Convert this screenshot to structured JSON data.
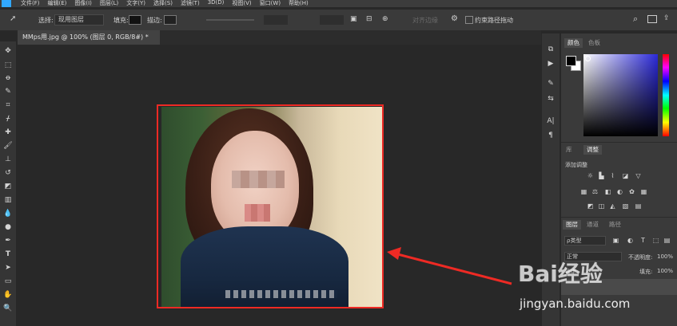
{
  "app": {
    "brand_color": "#31a8ff",
    "logo_text": "Ps"
  },
  "menu": [
    "文件(F)",
    "编辑(E)",
    "图像(I)",
    "图层(L)",
    "文字(Y)",
    "选择(S)",
    "滤镜(T)",
    "3D(D)",
    "视图(V)",
    "窗口(W)",
    "帮助(H)"
  ],
  "options": {
    "select_label": "选择:",
    "select_value": "现用图层",
    "fill_label": "填充:",
    "stroke_label": "描边:",
    "path_ops_label": "对齐边缘",
    "constrain_label": "约束路径拖动"
  },
  "document": {
    "tab_title": "MMps用.jpg @ 100% (图层 0, RGB/8#) *"
  },
  "color_panel": {
    "tabs": [
      "颜色",
      "色板"
    ],
    "active_tab": "颜色",
    "hue_color": "#2b29d9"
  },
  "adjust_panel": {
    "tabs": [
      "库",
      "调整"
    ],
    "active_tab": "调整",
    "title": "添加调整"
  },
  "layers_panel": {
    "tabs": [
      "图层",
      "通道",
      "路径"
    ],
    "active_tab": "图层",
    "kind_label": "ρ类型",
    "mode_value": "正常",
    "opacity_label": "不透明度:",
    "opacity_value": "100%",
    "lock_label": "锁定:",
    "fill_label": "填充:",
    "fill_value": "100%"
  },
  "annotation": {
    "box_color": "#ee2a24"
  },
  "watermark": {
    "text": "Bai经验",
    "url": "jingyan.baidu.com"
  }
}
